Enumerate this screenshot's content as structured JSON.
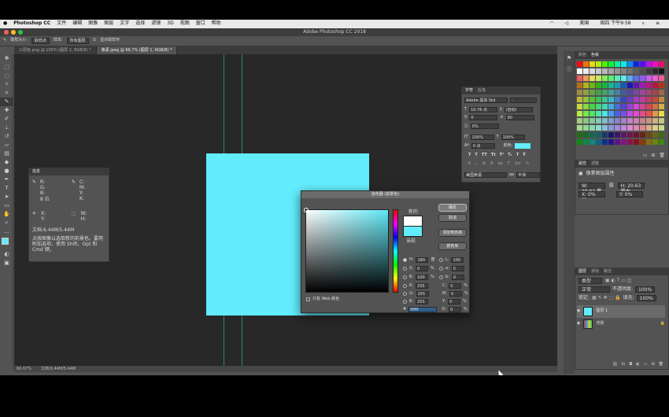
{
  "menubar": {
    "app": "Photoshop CC",
    "items": [
      "文件",
      "编辑",
      "图像",
      "图层",
      "文字",
      "选择",
      "滤镜",
      "3D",
      "视图",
      "窗口",
      "帮助"
    ],
    "right": [
      "美国",
      "周四 下午9:58"
    ]
  },
  "window": {
    "title": "Adobe Photoshop CC 2018"
  },
  "options": {
    "sample_size_label": "取样大小:",
    "sample_size": "取样点",
    "sample_label": "样本:",
    "sample": "所有图层",
    "show_ring": "显示取样环"
  },
  "tabs": [
    {
      "label": "三原色.png @ 100% (图层 2, RGB/8) *"
    },
    {
      "label": "像素.jpeg @ 66.7% (图层 1, RGB/8) *"
    }
  ],
  "status": {
    "zoom": "66.67%",
    "doc": "文档:6.44M/5.44M"
  },
  "info_panel": {
    "tab": "信息",
    "rgb": [
      "R:",
      "G:",
      "B:"
    ],
    "bits": "8 位",
    "cmyk": [
      "C:",
      "M:",
      "Y:",
      "K:"
    ],
    "xy": [
      "X:",
      "Y:"
    ],
    "wh": [
      "W:",
      "H:"
    ],
    "doc": "文档:6.44M/5.44M",
    "hint": "点按图像以选取新的前景色。要用附加选项，使用 Shift、Opt 和 Cmd 键。"
  },
  "character_panel": {
    "tabs": [
      "字符",
      "段落"
    ],
    "font": "Adobe 黑体 Std",
    "style": "-",
    "size": "10.76 点",
    "leading": "(自动)",
    "kerning": "0",
    "tracking": "80",
    "scale_v": "100%",
    "scale_h": "100%",
    "baseline": "0 点",
    "color_label": "颜色:",
    "language": "美国英语",
    "aa": "平滑",
    "pct": "0%"
  },
  "swatches_panel": {
    "tabs": [
      "颜色",
      "色板"
    ]
  },
  "properties_panel": {
    "tabs": [
      "属性",
      "调整"
    ],
    "sub": "像素图层属性",
    "w": "W: 20.61 厘米",
    "h": "H: 20.63 厘米",
    "x": "X: 0%",
    "y": "Y: 0%"
  },
  "layers_panel": {
    "tabs": [
      "图层",
      "通道",
      "路径"
    ],
    "kind": "类型",
    "mode": "正常",
    "opacity_label": "不透明度:",
    "opacity": "100%",
    "lock_label": "锁定:",
    "fill_label": "填充:",
    "fill": "100%",
    "layers": [
      {
        "name": "图层 1",
        "active": true
      },
      {
        "name": "背景",
        "active": false
      }
    ]
  },
  "color_picker": {
    "title": "拾色器 (前景色)",
    "new_label": "新的",
    "current_label": "当前",
    "ok": "确定",
    "cancel": "取消",
    "add_swatch": "添加到色板",
    "libraries": "颜色库",
    "web_only": "只有 Web 颜色",
    "H": "180",
    "S": "0",
    "Bv": "100",
    "R": "255",
    "G": "255",
    "B": "255",
    "L": "100",
    "a": "0",
    "b": "0",
    "C": "0",
    "M": "0",
    "Y": "0",
    "K": "0",
    "hex": "ffffff",
    "deg": "度",
    "pct": "%"
  },
  "colors": {
    "document": "#62ecfc",
    "guide": "#2bd3bf"
  }
}
